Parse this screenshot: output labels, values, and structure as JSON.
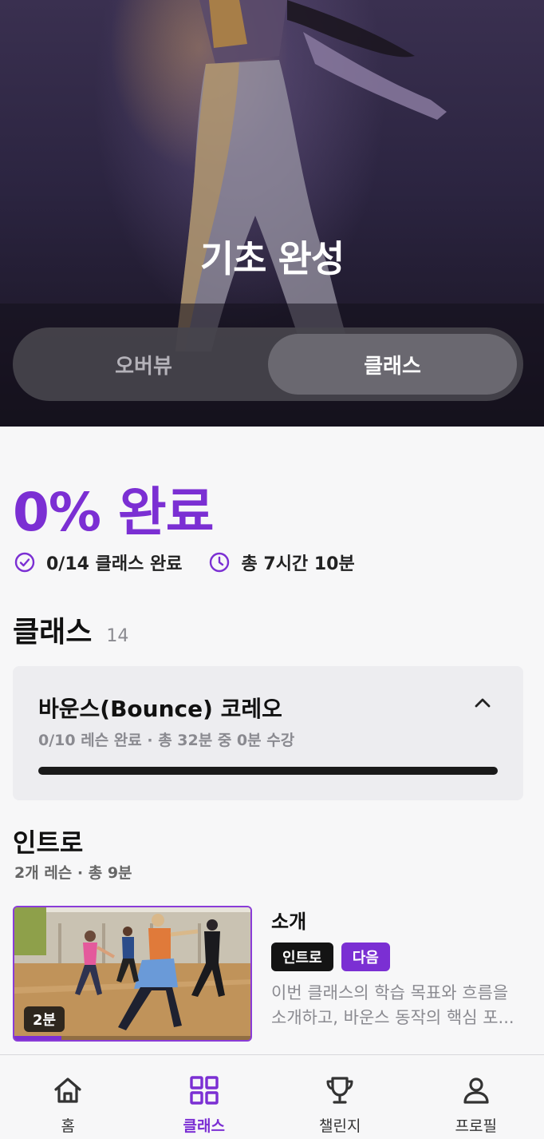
{
  "hero": {
    "title": "기초 완성",
    "tabs": [
      {
        "label": "오버뷰",
        "active": false
      },
      {
        "label": "클래스",
        "active": true
      }
    ]
  },
  "progress": {
    "percent_label": "0% 완료",
    "classes_done": "0/14 클래스 완료",
    "total_time": "총 7시간 10분"
  },
  "classes_section": {
    "title": "클래스",
    "count": "14"
  },
  "course": {
    "title": "바운스(Bounce) 코레오",
    "subtitle": "0/10 레슨 완료 · 총 32분 중 0분 수강",
    "progress": 0,
    "expanded": true
  },
  "chapter": {
    "title": "인트로",
    "subtitle": "2개 레슨 · 총 9분"
  },
  "lesson": {
    "title": "소개",
    "duration": "2분",
    "tags": [
      "인트로",
      "다음"
    ],
    "description": "이번 클래스의 학습 목표와 흐름을 소개하고, 바운스 동작의 핵심 포...",
    "watched_fraction": 0.2
  },
  "nav": {
    "items": [
      {
        "label": "홈",
        "icon": "home-icon",
        "active": false
      },
      {
        "label": "클래스",
        "icon": "grid-icon",
        "active": true
      },
      {
        "label": "챌린지",
        "icon": "trophy-icon",
        "active": false
      },
      {
        "label": "프로필",
        "icon": "person-icon",
        "active": false
      }
    ]
  },
  "colors": {
    "accent": "#7b2fd3",
    "hero_bg": "#2b2440",
    "page_bg": "#f7f7f8"
  }
}
